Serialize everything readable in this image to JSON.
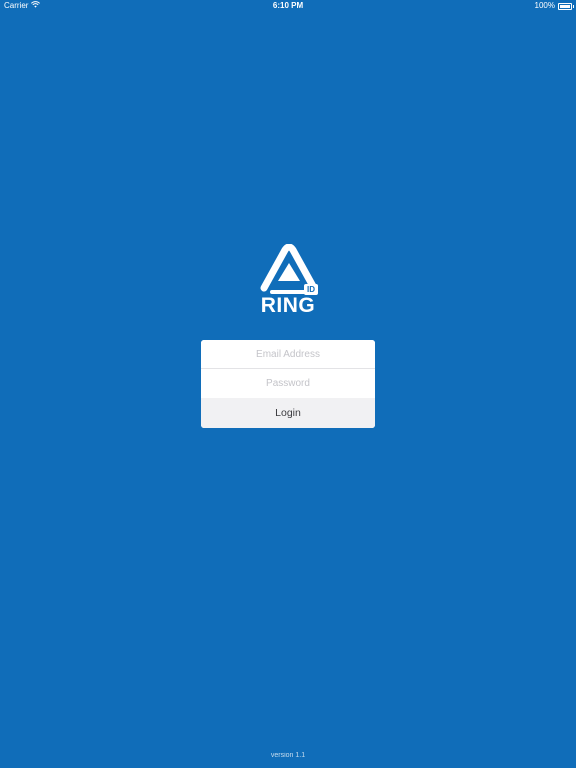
{
  "status_bar": {
    "carrier": "Carrier",
    "time": "6:10 PM",
    "battery": "100%"
  },
  "logo": {
    "word": "RING",
    "badge": "ID"
  },
  "login_form": {
    "email_placeholder": "Email Address",
    "email_value": "",
    "password_placeholder": "Password",
    "password_value": "",
    "login_label": "Login"
  },
  "footer": {
    "version": "version 1.1"
  },
  "colors": {
    "background": "#106db9",
    "card": "#ffffff",
    "button": "#f1f1f3",
    "placeholder": "#c4c4c9"
  }
}
